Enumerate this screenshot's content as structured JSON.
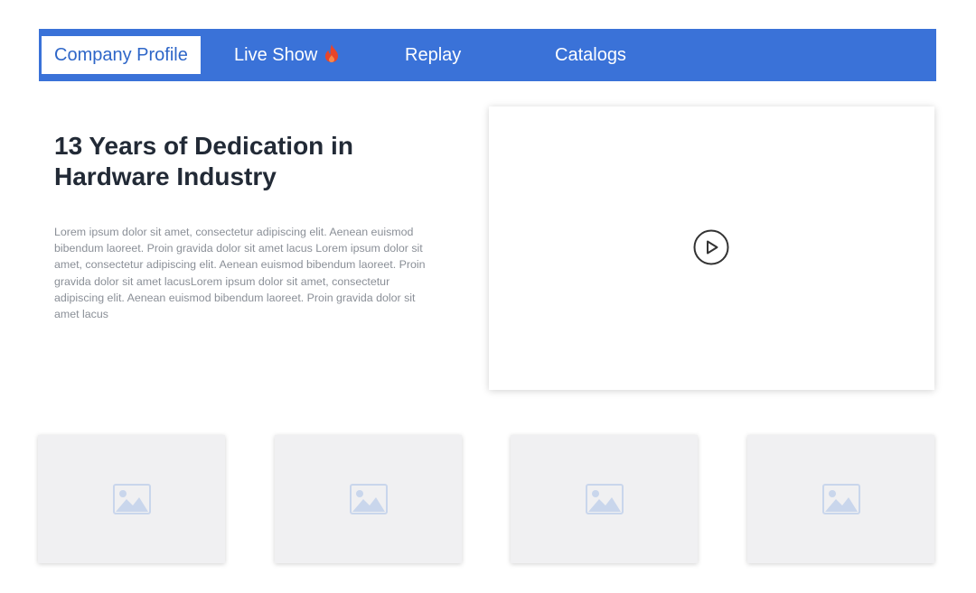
{
  "nav": {
    "tabs": [
      {
        "label": "Company Profile",
        "active": true
      },
      {
        "label": "Live Show",
        "icon": "fire-icon"
      },
      {
        "label": "Replay"
      },
      {
        "label": "Catalogs"
      }
    ]
  },
  "main": {
    "headline": "13 Years of Dedication in Hardware Industry",
    "description": "Lorem ipsum dolor sit amet, consectetur adipiscing elit. Aenean euismod bibendum laoreet. Proin gravida dolor sit amet lacus Lorem ipsum dolor sit amet, consectetur adipiscing elit. Aenean euismod bibendum laoreet. Proin gravida dolor sit amet lacusLorem ipsum dolor sit amet, consectetur adipiscing elit. Aenean euismod bibendum laoreet. Proin gravida dolor sit amet lacus",
    "video": {
      "icon": "play-icon"
    }
  },
  "gallery": {
    "count": 4,
    "icon": "image-placeholder-icon"
  },
  "colors": {
    "nav_background": "#3a72d8",
    "active_tab_text": "#2e66c8",
    "fire_icon": "#e8452a",
    "placeholder_icon": "#c9d6ec"
  }
}
